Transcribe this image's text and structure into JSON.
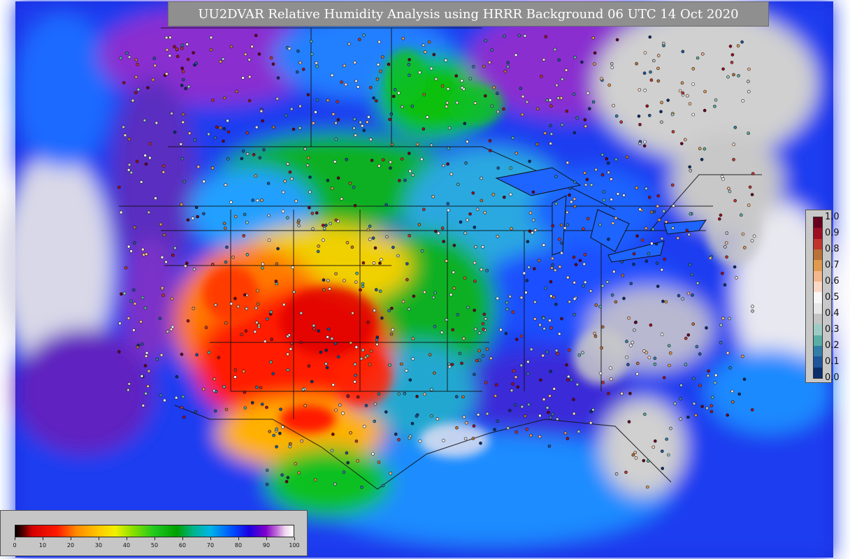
{
  "title": "UU2DVAR Relative Humidity Analysis using HRRR Background 06 UTC 14 Oct 2020",
  "obs_legend": {
    "ticks": [
      "1.0",
      "0.9",
      "0.8",
      "0.7",
      "0.6",
      "0.5",
      "0.4",
      "0.3",
      "0.2",
      "0.1",
      "0.0"
    ],
    "colors_top_to_bottom": [
      "#67001f",
      "#9c0f22",
      "#c0352e",
      "#b87237",
      "#e09a4f",
      "#f2b78e",
      "#fbd8c6",
      "#f7f7f7",
      "#e6e6e6",
      "#c3c3c3",
      "#9dcbc3",
      "#5aaea3",
      "#337ea8",
      "#1f559a",
      "#0a2f6b"
    ]
  },
  "rh_legend": {
    "ticks": [
      "0",
      "10",
      "20",
      "30",
      "40",
      "50",
      "60",
      "70",
      "80",
      "90",
      "100"
    ],
    "stops": [
      {
        "v": 0,
        "c": "#000000"
      },
      {
        "v": 3,
        "c": "#5a0000"
      },
      {
        "v": 6,
        "c": "#d40000"
      },
      {
        "v": 15,
        "c": "#ff1a00"
      },
      {
        "v": 22,
        "c": "#ff8a00"
      },
      {
        "v": 30,
        "c": "#ffc800"
      },
      {
        "v": 36,
        "c": "#f0f000"
      },
      {
        "v": 42,
        "c": "#8ce000"
      },
      {
        "v": 50,
        "c": "#1fc81f"
      },
      {
        "v": 58,
        "c": "#00a000"
      },
      {
        "v": 64,
        "c": "#00b48c"
      },
      {
        "v": 70,
        "c": "#00b4e6"
      },
      {
        "v": 78,
        "c": "#0050ff"
      },
      {
        "v": 84,
        "c": "#1a00e0"
      },
      {
        "v": 90,
        "c": "#8000c8"
      },
      {
        "v": 94,
        "c": "#c070d8"
      },
      {
        "v": 97,
        "c": "#f0d8f0"
      },
      {
        "v": 100,
        "c": "#ffffff"
      }
    ]
  },
  "palette": {
    "ocean": "#1a2ee0",
    "land_land_moist": "#1e64ff",
    "gray_saturated": "#cccccc"
  }
}
